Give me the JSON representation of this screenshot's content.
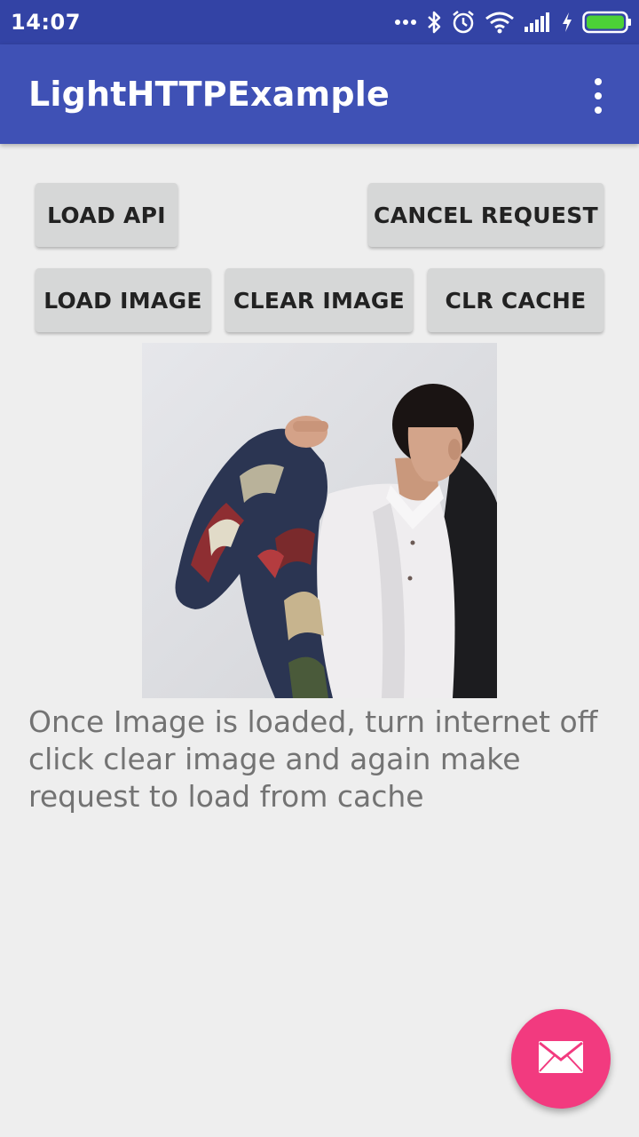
{
  "status_bar": {
    "time": "14:07",
    "icons": [
      "more-dots-icon",
      "bluetooth-icon",
      "alarm-icon",
      "wifi-icon",
      "signal-icon",
      "charging-icon",
      "battery-icon"
    ],
    "battery_color": "#4cd137"
  },
  "app_bar": {
    "title": "LightHTTPExample",
    "menu_icon": "overflow-menu-icon",
    "color": "#3f51b5"
  },
  "buttons": {
    "load_api": "LOAD API",
    "cancel_request": "CANCEL REQUEST",
    "load_image": "LOAD IMAGE",
    "clear_image": "CLEAR IMAGE",
    "clr_cache": "CLR CACHE"
  },
  "image": {
    "description_icon": "loaded-photo"
  },
  "info": {
    "text": "Once Image is loaded, turn internet off click clear image and again make request to load from cache"
  },
  "fab": {
    "icon": "mail-icon",
    "color": "#f23a7f"
  }
}
